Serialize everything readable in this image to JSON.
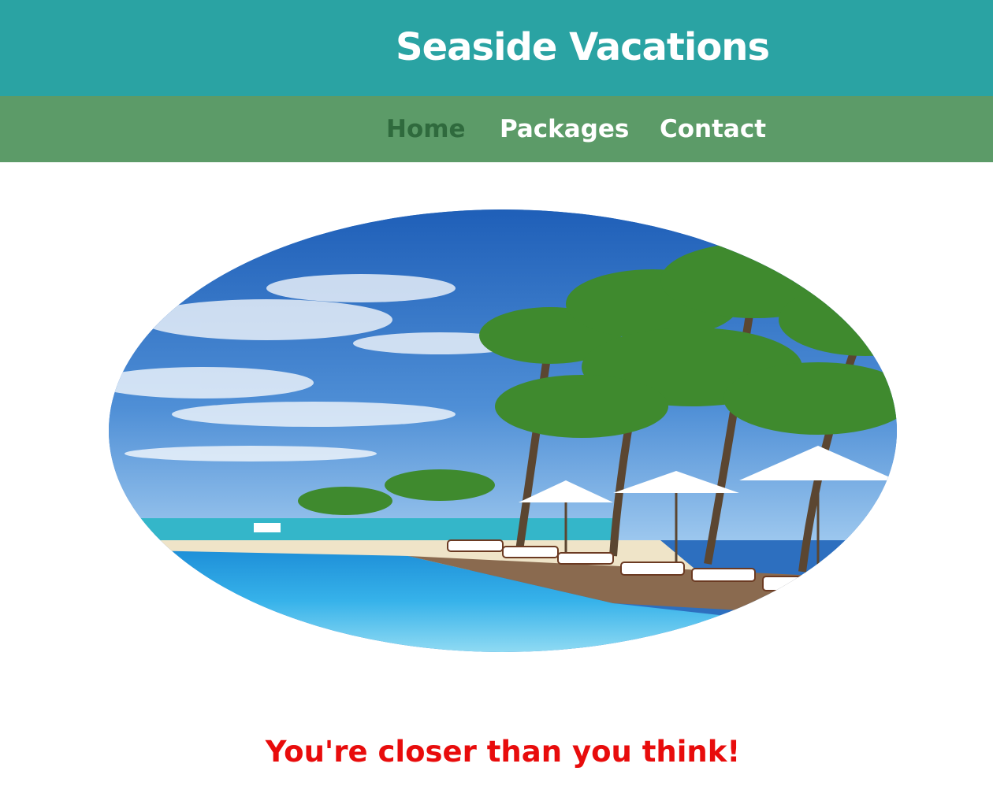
{
  "header": {
    "site_title": "Seaside Vacations",
    "background_color": "#2aa3a3"
  },
  "nav": {
    "background_color": "#5c9b68",
    "items": [
      {
        "label": "Home",
        "active": true
      },
      {
        "label": "Packages",
        "active": false
      },
      {
        "label": "Contact",
        "active": false
      }
    ]
  },
  "hero": {
    "image_subject": "tropical resort infinity pool with palm trees, umbrellas and sun loungers"
  },
  "main": {
    "tagline": "You're closer than you think!",
    "tagline_color": "#e80c0c"
  }
}
